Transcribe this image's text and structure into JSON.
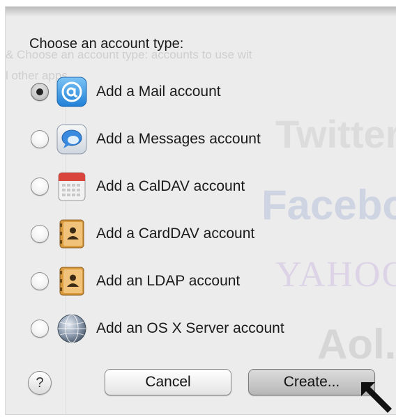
{
  "dialog": {
    "prompt": "Choose an account type:",
    "background_text_line1": "& Choose an account type: accounts to use wit",
    "background_text_line2": "l other apps.",
    "background_logos": [
      "Twitter",
      "Facebook",
      "YAHOO",
      "Aol."
    ],
    "options": [
      {
        "label": "Add a Mail account",
        "icon": "mail-icon",
        "selected": true
      },
      {
        "label": "Add a Messages account",
        "icon": "messages-icon",
        "selected": false
      },
      {
        "label": "Add a CalDAV account",
        "icon": "calendar-icon",
        "selected": false
      },
      {
        "label": "Add a CardDAV account",
        "icon": "contacts-icon",
        "selected": false
      },
      {
        "label": "Add an LDAP account",
        "icon": "contacts-icon",
        "selected": false
      },
      {
        "label": "Add an OS X Server account",
        "icon": "server-globe-icon",
        "selected": false
      }
    ],
    "help_label": "?",
    "cancel_label": "Cancel",
    "create_label": "Create..."
  },
  "colors": {
    "sheet_background": "#ececec",
    "mail_icon_blue": "#2a8fe0",
    "calendar_red": "#d9443c",
    "contacts_brown": "#c98a2e"
  }
}
